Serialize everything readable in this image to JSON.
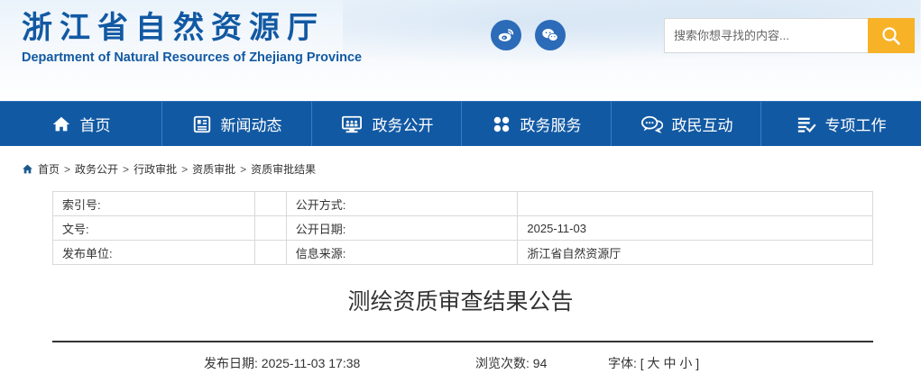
{
  "header": {
    "title_cn": "浙江省自然资源厅",
    "title_en": "Department of Natural Resources of Zhejiang Province",
    "social": [
      {
        "name": "weibo-icon"
      },
      {
        "name": "wechat-icon"
      }
    ],
    "search": {
      "placeholder": "搜索你想寻找的内容...",
      "button_icon": "search-icon"
    }
  },
  "nav": {
    "items": [
      {
        "label": "首页",
        "icon": "home-icon"
      },
      {
        "label": "新闻动态",
        "icon": "news-icon"
      },
      {
        "label": "政务公开",
        "icon": "monitor-icon"
      },
      {
        "label": "政务服务",
        "icon": "grid-icon"
      },
      {
        "label": "政民互动",
        "icon": "chat-icon"
      },
      {
        "label": "专项工作",
        "icon": "checklist-icon"
      }
    ]
  },
  "breadcrumb": [
    "首页",
    "政务公开",
    "行政审批",
    "资质审批",
    "资质审批结果"
  ],
  "meta_table": [
    {
      "label1": "索引号:",
      "value1": "",
      "label2": "公开方式:",
      "value2": ""
    },
    {
      "label1": "文号:",
      "value1": "",
      "label2": "公开日期:",
      "value2": "2025-11-03"
    },
    {
      "label1": "发布单位:",
      "value1": "",
      "label2": "信息来源:",
      "value2": "浙江省自然资源厅"
    }
  ],
  "article": {
    "title": "测绘资质审查结果公告",
    "publish_date": "发布日期: 2025-11-03 17:38",
    "views": "浏览次数: 94",
    "font_size": "字体: [ 大 中 小 ]"
  },
  "colors": {
    "brand_blue": "#1259a3",
    "search_button": "#f7b227"
  }
}
